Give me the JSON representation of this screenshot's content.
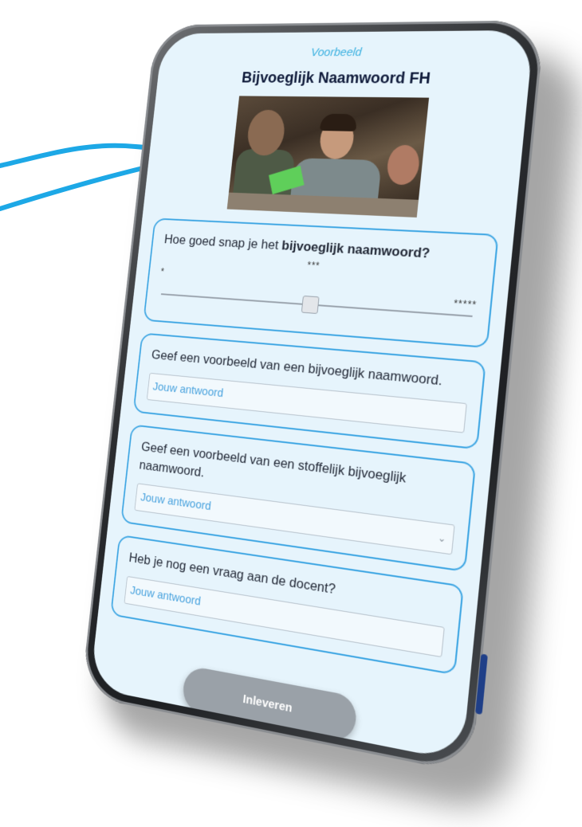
{
  "header": {
    "tag": "Voorbeeld",
    "title": "Bijvoeglijk Naamwoord FH"
  },
  "photo": {
    "description_icon": "video-still"
  },
  "slider_question": {
    "text_prefix": "Hoe goed snap je het ",
    "text_bold": "bijvoeglijk naamwoord?",
    "scale_min": "*",
    "scale_mid": "***",
    "scale_max": "*****",
    "value_fraction": 0.5
  },
  "questions": [
    {
      "text": "Geef een voorbeeld van een bijvoeglijk naamwoord.",
      "placeholder": "Jouw antwoord",
      "has_dropdown": false
    },
    {
      "text": "Geef een voorbeeld van een stoffelijk bijvoeglijk naamwoord.",
      "placeholder": "Jouw antwoord",
      "has_dropdown": true
    },
    {
      "text": "Heb je nog een vraag aan de docent?",
      "placeholder": "Jouw antwoord",
      "has_dropdown": false
    }
  ],
  "submit_label": "Inleveren",
  "colors": {
    "accent": "#3ea6e3",
    "screen_bg": "#e6f4fc",
    "arrow": "#1da8e6",
    "submit_bg": "#9aa1a8"
  }
}
